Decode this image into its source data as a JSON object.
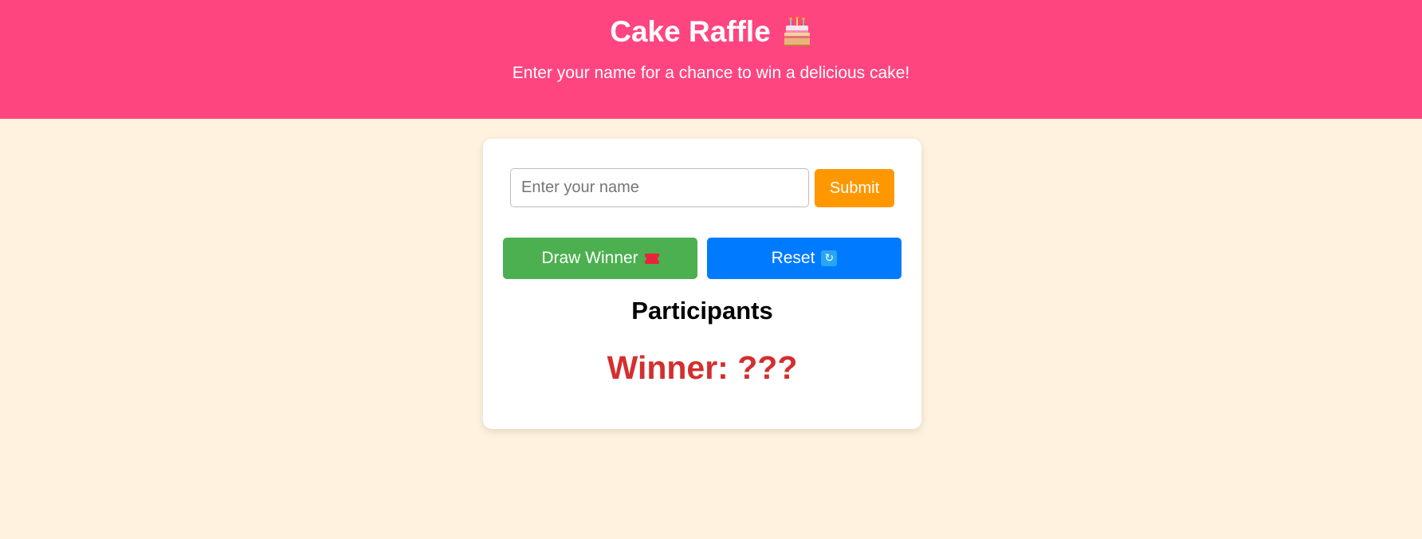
{
  "header": {
    "title": "Cake Raffle",
    "title_icon": "birthday-cake-icon",
    "subtitle": "Enter your name for a chance to win a delicious cake!",
    "background_color": "#ff4580"
  },
  "form": {
    "name_placeholder": "Enter your name",
    "name_value": "",
    "submit_label": "Submit",
    "submit_color": "#ff9800"
  },
  "actions": {
    "draw_label": "Draw Winner",
    "draw_icon": "ticket-icon",
    "draw_color": "#4caf50",
    "reset_label": "Reset",
    "reset_icon": "refresh-icon",
    "reset_color": "#007bff"
  },
  "participants": {
    "heading": "Participants",
    "items": []
  },
  "winner": {
    "text": "Winner: ???",
    "color": "#d32f2f"
  },
  "page": {
    "background_color": "#fff3df"
  }
}
